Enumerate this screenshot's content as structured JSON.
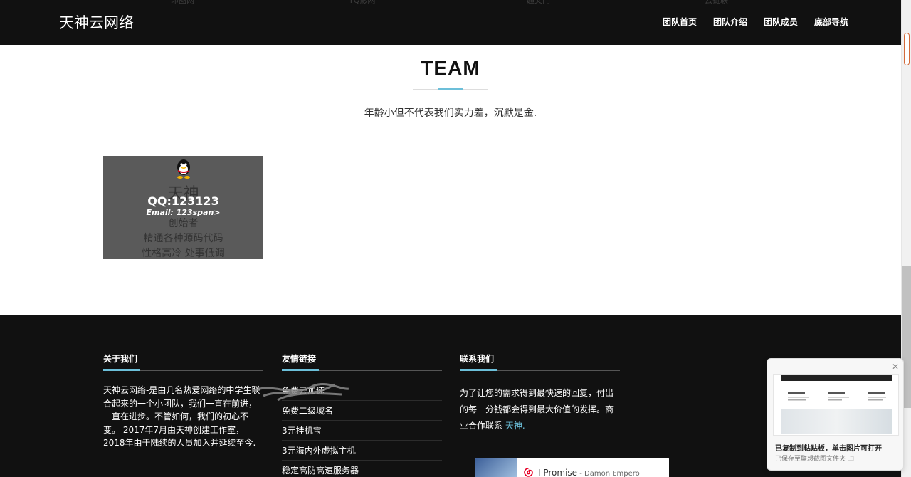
{
  "header": {
    "brand": "天神云网络",
    "ghost_links": [
      "印图网",
      "TQ影网",
      "超文门",
      "云链联"
    ],
    "nav": [
      "团队首页",
      "团队介绍",
      "团队成员",
      "底部导航"
    ]
  },
  "team": {
    "title": "TEAM",
    "subtitle": "年龄小但不代表我们实力差，沉默是金.",
    "member": {
      "name": "天神",
      "qq": "QQ:123123",
      "email": "Email:  123span>",
      "role": "创始者",
      "skill": "精通各种源码代码",
      "trait": "性格高冷 处事低调"
    }
  },
  "footer": {
    "about": {
      "heading": "关于我们",
      "text": "天神云网络-是由几名热爱网络的中学生联合起来的一个小团队，我们一直在前进，一直在进步。不管如何，我们的初心不变。 2017年7月由天神创建工作室，2018年由于陆续的人员加入并延续至今."
    },
    "links": {
      "heading": "友情链接",
      "items": [
        "免费云加速",
        "免费二级域名",
        "3元挂机宝",
        "3元海内外虚拟主机",
        "稳定高防高速服务器"
      ]
    },
    "contact": {
      "heading": "联系我们",
      "text": "为了让您的需求得到最快速的回复，付出的每一分钱都会得到最大价值的发挥。商业合作联系 ",
      "link": "天神."
    }
  },
  "music": {
    "song": "I Promise",
    "artist": " - Damon Empero"
  },
  "toast": {
    "close": "✕",
    "title": "已复制到粘贴板，单击图片可打开",
    "subtitle": "已保存至联想截图文件夹 🗀"
  },
  "colors": {
    "accent": "#6cbfd9",
    "header_bg": "#111111",
    "footer_bg": "#111111",
    "card_bg": "#5a5a5a"
  }
}
